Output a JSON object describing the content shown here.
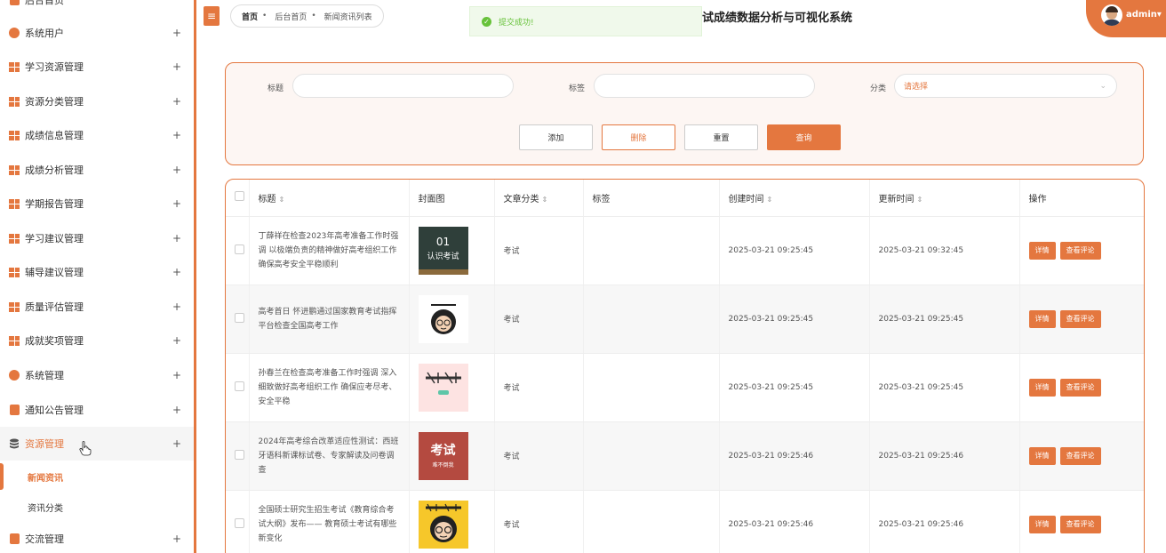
{
  "sidebar": {
    "items": [
      {
        "label": "后台首页",
        "icon": "home-icon"
      },
      {
        "label": "系统用户",
        "icon": "user-icon"
      },
      {
        "label": "学习资源管理",
        "icon": "grid-icon"
      },
      {
        "label": "资源分类管理",
        "icon": "grid-icon"
      },
      {
        "label": "成绩信息管理",
        "icon": "grid-icon"
      },
      {
        "label": "成绩分析管理",
        "icon": "grid-icon"
      },
      {
        "label": "学期报告管理",
        "icon": "grid-icon"
      },
      {
        "label": "学习建议管理",
        "icon": "grid-icon"
      },
      {
        "label": "辅导建议管理",
        "icon": "grid-icon"
      },
      {
        "label": "质量评估管理",
        "icon": "grid-icon"
      },
      {
        "label": "成就奖项管理",
        "icon": "grid-icon"
      },
      {
        "label": "系统管理",
        "icon": "settings-icon"
      },
      {
        "label": "通知公告管理",
        "icon": "notice-icon"
      },
      {
        "label": "资源管理",
        "icon": "database-icon"
      },
      {
        "label": "交流管理",
        "icon": "chat-icon"
      }
    ],
    "expand_symbol": "+",
    "subitems": [
      {
        "label": "新闻资讯"
      },
      {
        "label": "资讯分类"
      }
    ]
  },
  "header": {
    "toggle_symbol": "≡",
    "breadcrumb": [
      "首页",
      "后台首页",
      "新闻资讯列表"
    ],
    "toast": "提交成功!",
    "system_title": "试成绩数据分析与可视化系统",
    "user_name": "admin",
    "user_caret": "▾"
  },
  "search": {
    "title_label": "标题",
    "tag_label": "标签",
    "category_label": "分类",
    "category_placeholder": "请选择",
    "buttons": {
      "add": "添加",
      "delete": "删除",
      "reset": "重置",
      "query": "查询"
    }
  },
  "table": {
    "headers": {
      "title": "标题",
      "cover": "封面图",
      "category": "文章分类",
      "tag": "标签",
      "created": "创建时间",
      "updated": "更新时间",
      "ops": "操作"
    },
    "sort_symbol": "⇕",
    "detail_label": "详情",
    "comment_label": "查看评论",
    "rows": [
      {
        "title": "丁薛祥在检查2023年高考准备工作时强调 以极端负责的精神做好高考组织工作 确保高考安全平稳顺利",
        "category": "考试",
        "tag": "",
        "created": "2025-03-21 09:25:45",
        "updated": "2025-03-21 09:32:45",
        "cover_text_1": "01",
        "cover_text_2": "认识考试"
      },
      {
        "title": "高考首日 怀进鹏通过国家教育考试指挥平台检查全国高考工作",
        "category": "考试",
        "tag": "",
        "created": "2025-03-21 09:25:45",
        "updated": "2025-03-21 09:25:45"
      },
      {
        "title": "孙春兰在检查高考准备工作时强调 深入细致做好高考组织工作 确保应考尽考、安全平稳",
        "category": "考试",
        "tag": "",
        "created": "2025-03-21 09:25:45",
        "updated": "2025-03-21 09:25:45"
      },
      {
        "title": "2024年高考综合改革适应性测试：西班牙语科新课标试卷、专家解读及问卷调查",
        "category": "考试",
        "tag": "",
        "created": "2025-03-21 09:25:46",
        "updated": "2025-03-21 09:25:46",
        "cover_text_1": "考试",
        "cover_text_2": "难不倒我"
      },
      {
        "title": "全国硕士研究生招生考试《教育综合考试大纲》发布—— 教育硕士考试有哪些新变化",
        "category": "考试",
        "tag": "",
        "created": "2025-03-21 09:25:46",
        "updated": "2025-03-21 09:25:46"
      }
    ]
  },
  "colors": {
    "accent": "#e4773f",
    "success": "#67c23a"
  }
}
